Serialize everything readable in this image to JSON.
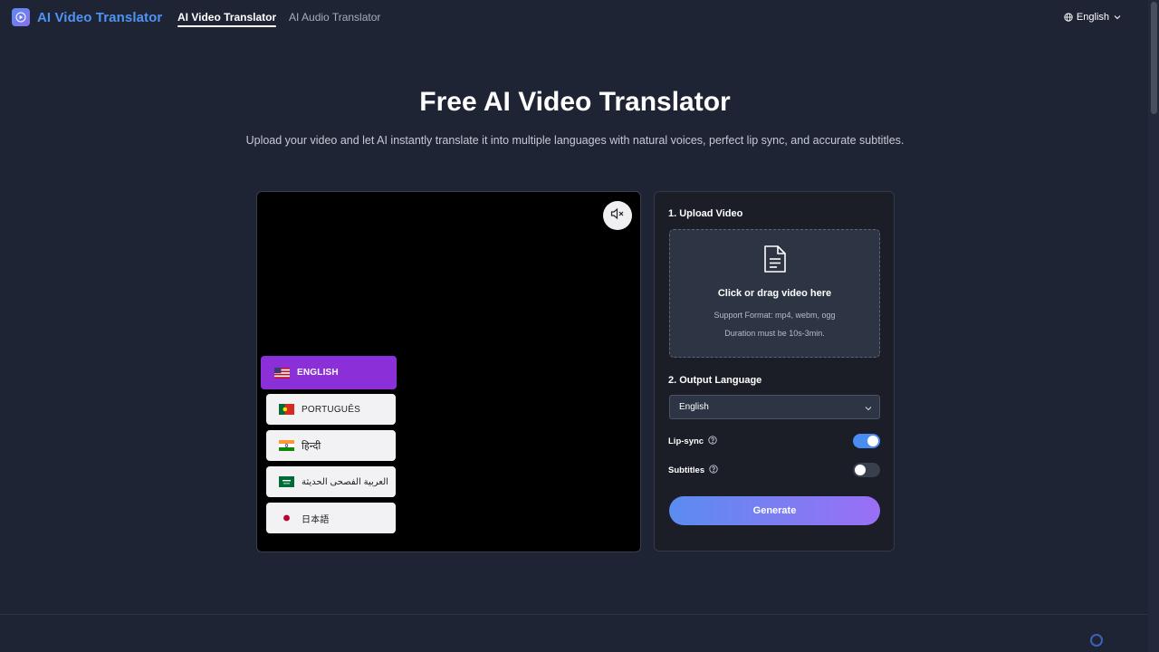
{
  "brand": {
    "name": "AI Video Translator",
    "icon": "video-play-icon",
    "accent": "#4f93f4"
  },
  "nav": {
    "items": [
      {
        "label": "AI Video Translator",
        "active": true
      },
      {
        "label": "AI Audio Translator",
        "active": false
      }
    ]
  },
  "language_switch": {
    "label": "English",
    "icon": "globe-icon"
  },
  "hero": {
    "title": "Free AI Video Translator",
    "subtitle": "Upload your video and let AI instantly translate it into multiple languages with natural voices, perfect lip sync, and accurate subtitles."
  },
  "preview": {
    "mute_icon": "speaker-muted-icon",
    "languages": [
      {
        "label": "ENGLISH",
        "flag": "us-flag-icon",
        "active": true
      },
      {
        "label": "PORTUGUÊS",
        "flag": "portugal-flag-icon",
        "active": false
      },
      {
        "label": "हिन्दी",
        "flag": "india-flag-icon",
        "active": false
      },
      {
        "label": "العربية الفصحى الحديثة",
        "flag": "saudi-flag-icon",
        "active": false
      },
      {
        "label": "日本語",
        "flag": "japan-flag-icon",
        "active": false
      }
    ],
    "active_color": "#8b2fd8"
  },
  "panel": {
    "upload_label": "1. Upload Video",
    "dropzone": {
      "icon": "document-icon",
      "title": "Click or drag video here",
      "format_line": "Support Format: mp4, webm, ogg",
      "duration_line": "Duration must be 10s-3min."
    },
    "output_label": "2. Output Language",
    "output_language": "English",
    "lipsync": {
      "label": "Lip-sync",
      "on": true
    },
    "subtitles": {
      "label": "Subtitles",
      "on": false
    },
    "generate_label": "Generate"
  }
}
